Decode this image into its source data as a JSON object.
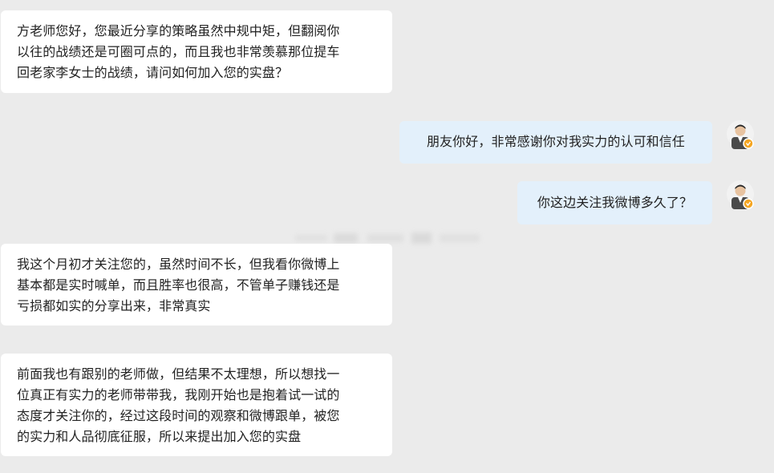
{
  "messages": [
    {
      "side": "incoming",
      "lines": [
        "方老师您好，您最近分享的策略虽然中规中矩，但翻阅你",
        "以往的战绩还是可圈可点的，而且我也非常羡慕那位提车",
        "回老家李女士的战绩，请问如何加入您的实盘？"
      ]
    },
    {
      "side": "outgoing",
      "text": "朋友你好，非常感谢你对我实力的认可和信任"
    },
    {
      "side": "outgoing",
      "text": "你这边关注我微博多久了？"
    },
    {
      "side": "incoming",
      "lines": [
        "我这个月初才关注您的，虽然时间不长，但我看你微博上",
        "基本都是实时喊单，而且胜率也很高，不管单子赚钱还是",
        "亏损都如实的分享出来，非常真实"
      ]
    },
    {
      "side": "incoming",
      "lines": [
        "前面我也有跟别的老师做，但结果不太理想，所以想找一",
        "位真正有实力的老师带带我，我刚开始也是抱着试一试的",
        "态度才关注你的，经过这段时间的观察和微博跟单，被您",
        "的实力和人品彻底征服，所以来提出加入您的实盘"
      ]
    }
  ],
  "colors": {
    "background": "#ebebeb",
    "incoming_bubble": "#ffffff",
    "outgoing_bubble": "#e3f0fb",
    "verified_badge": "#f5a623"
  },
  "icons": {
    "avatar": "user-avatar-icon",
    "verified": "verified-badge-icon"
  }
}
